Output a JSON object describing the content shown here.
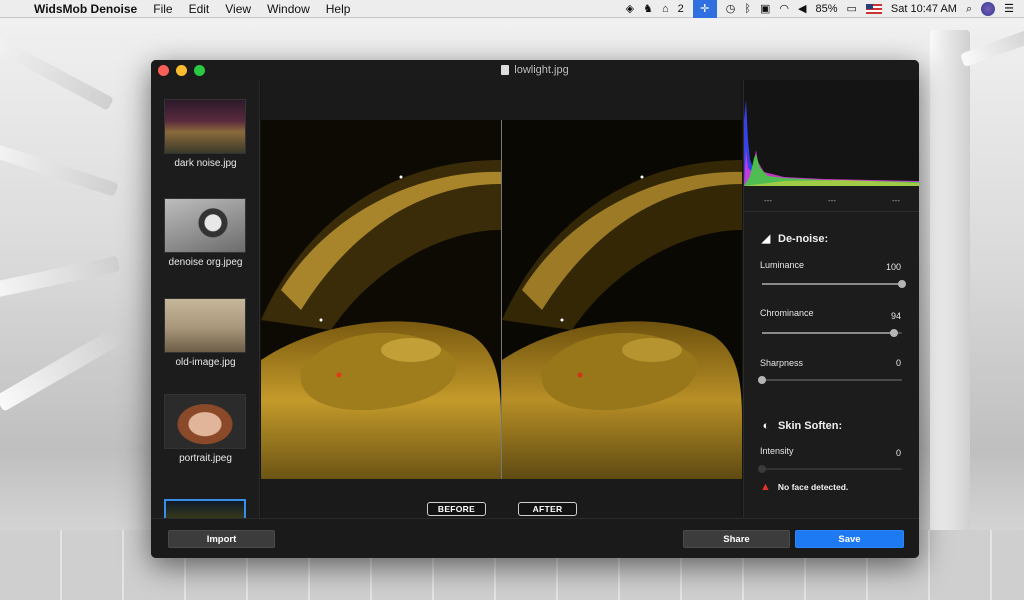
{
  "menubar": {
    "app_name": "WidsMob Denoise",
    "menus": [
      "File",
      "Edit",
      "View",
      "Window",
      "Help"
    ],
    "status": {
      "adobe_badge": "2",
      "battery": "85%",
      "clock": "Sat 10:47 AM"
    }
  },
  "window": {
    "title": "lowlight.jpg"
  },
  "sidebar": {
    "items": [
      {
        "label": "dark noise.jpg"
      },
      {
        "label": "denoise org.jpeg"
      },
      {
        "label": "old-image.jpg"
      },
      {
        "label": "portrait.jpeg"
      }
    ]
  },
  "canvas": {
    "before_label": "BEFORE",
    "after_label": "AFTER"
  },
  "histogram": {
    "labels": [
      "---",
      "---",
      "---"
    ]
  },
  "denoise": {
    "title": "De-noise:",
    "luminance": {
      "label": "Luminance",
      "value": 100,
      "max": 100
    },
    "chrominance": {
      "label": "Chrominance",
      "value": 94,
      "max": 100
    },
    "sharpness": {
      "label": "Sharpness",
      "value": 0,
      "max": 100
    }
  },
  "skin": {
    "title": "Skin Soften:",
    "intensity": {
      "label": "Intensity",
      "value": 0,
      "max": 100
    },
    "warning": "No face detected."
  },
  "bottom": {
    "import_label": "Import",
    "share_label": "Share",
    "save_label": "Save"
  },
  "colors": {
    "accent": "#1d7af3",
    "warning": "#e0312a"
  }
}
